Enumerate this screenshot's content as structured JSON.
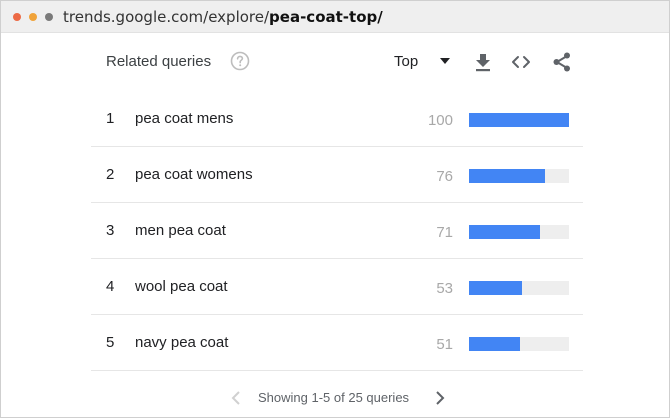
{
  "browser": {
    "url_base": "trends.google.com/explore/",
    "url_path": "pea-coat-top/"
  },
  "widget": {
    "title": "Related queries",
    "help_icon": "help-circle-icon",
    "filter_selected": "Top",
    "actions": [
      {
        "name": "download-icon"
      },
      {
        "name": "embed-code-icon"
      },
      {
        "name": "share-icon"
      }
    ]
  },
  "queries": [
    {
      "rank": "1",
      "query": "pea coat mens",
      "value": "100",
      "level": 100
    },
    {
      "rank": "2",
      "query": "pea coat womens",
      "value": "76",
      "level": 76
    },
    {
      "rank": "3",
      "query": "men pea coat",
      "value": "71",
      "level": 71
    },
    {
      "rank": "4",
      "query": "wool pea coat",
      "value": "53",
      "level": 53
    },
    {
      "rank": "5",
      "query": "navy pea coat",
      "value": "51",
      "level": 51
    }
  ],
  "pagination": {
    "info": "Showing 1-5 of 25 queries"
  },
  "colors": {
    "bar": "#4285f4",
    "bar_track": "#eeeeee"
  }
}
